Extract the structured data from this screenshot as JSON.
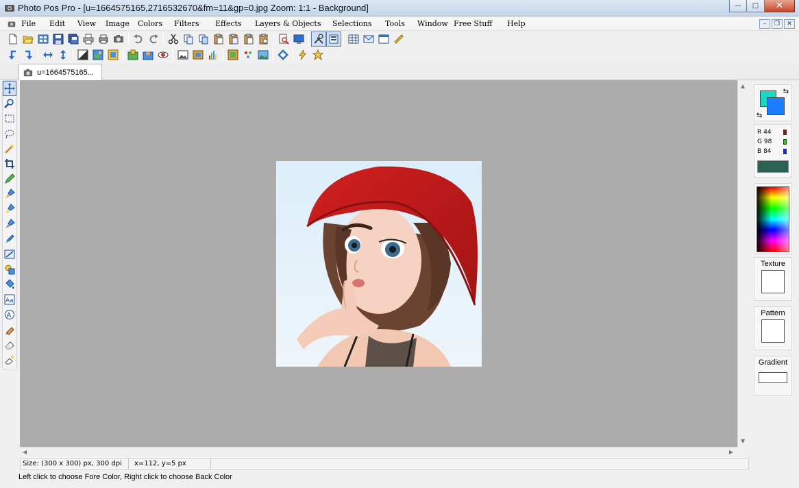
{
  "window": {
    "title": "Photo Pos Pro - [u=1664575165,2716532670&fm=11&gp=0.jpg  Zoom: 1:1 - Background]",
    "minimize": "—",
    "restore": "□",
    "close": "✕"
  },
  "menu": [
    "File",
    "Edit",
    "View",
    "Image",
    "Colors",
    "Filters",
    "Effects",
    "Layers & Objects",
    "Selections",
    "Tools",
    "Window",
    "Free Stuff",
    "Help"
  ],
  "mdi": {
    "minimize": "–",
    "restore": "❐",
    "close": "✕"
  },
  "document": {
    "tab_label": "u=1664575165..."
  },
  "status": {
    "size": "Size: (300 x 300) px, 300 dpi",
    "coords": "x=112, y=5 px",
    "hint": "Left click to choose Fore Color, Right click to choose Back Color"
  },
  "colors": {
    "fore": "#1fd6c0",
    "back": "#1a7cff",
    "current": "#2c6254",
    "r": {
      "label": "R",
      "value": "44"
    },
    "g": {
      "label": "G",
      "value": "98"
    },
    "b": {
      "label": "B",
      "value": "84"
    }
  },
  "panels": {
    "texture": "Texture",
    "pattern": "Pattern",
    "gradient": "Gradient"
  },
  "icons": {
    "toolbar1": [
      "new-icon",
      "open-icon",
      "browse-icon",
      "save-icon",
      "save-as-icon",
      "print-icon",
      "print-preview-icon",
      "scan-icon",
      "undo-icon",
      "redo-icon",
      "cut-icon",
      "copy-icon",
      "copy-merged-icon",
      "paste-icon",
      "paste-new-icon",
      "paste-layer-icon",
      "paste-object-icon",
      "zoom-fit-icon",
      "full-screen-icon",
      "tools-options-icon",
      "layers-panel-icon",
      "grid-icon",
      "email-icon",
      "window-icon",
      "ruler-icon"
    ],
    "toolbar2": [
      "rotate-left-icon",
      "rotate-right-icon",
      "flip-horizontal-icon",
      "flip-vertical-icon",
      "adjust-icon",
      "image-size-icon",
      "canvas-size-icon",
      "new-layer-icon",
      "layer-properties-icon",
      "red-eye-icon",
      "picture-icon",
      "picture-frame-icon",
      "histogram-icon",
      "frame-icon",
      "stars-icon",
      "landscape-icon",
      "diamond-icon",
      "lightning-icon",
      "favorites-star-icon"
    ],
    "tools": [
      "move-tool-icon",
      "zoom-tool-icon",
      "rect-select-icon",
      "lasso-select-icon",
      "magic-wand-icon",
      "crop-tool-icon",
      "pencil-icon",
      "brush-icon",
      "airbrush-icon",
      "clone-brush-icon",
      "smudge-icon",
      "gradient-fill-icon",
      "shape-tool-icon",
      "paint-bucket-icon",
      "text-tool-icon",
      "color-picker-icon",
      "eraser-brush-icon",
      "eraser-icon",
      "magic-eraser-icon"
    ]
  }
}
